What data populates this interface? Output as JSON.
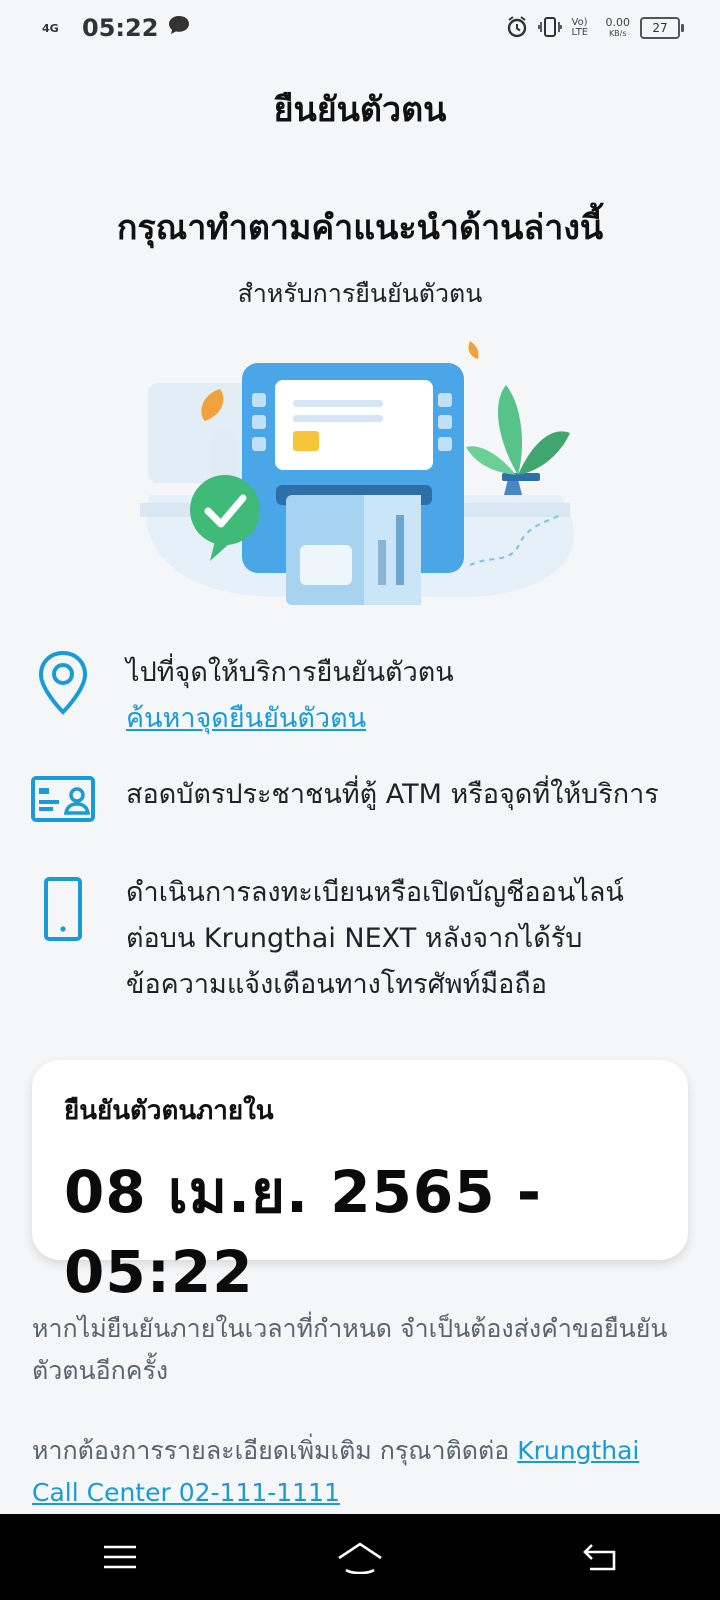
{
  "status_bar": {
    "network": "4G",
    "time": "05:22",
    "lte_label": "Vo) LTE",
    "speed": "0.00",
    "speed_unit": "KB/s",
    "battery": "27"
  },
  "page_title": "ยืนยันตัวตน",
  "heading": "กรุณาทำตามคำแนะนำด้านล่างนี้",
  "subheading": "สำหรับการยืนยันตัวตน",
  "steps": [
    {
      "icon": "location-pin-icon",
      "text": "ไปที่จุดให้บริการยืนยันตัวตน",
      "link": "ค้นหาจุดยืนยันตัวตน"
    },
    {
      "icon": "id-card-icon",
      "text": "สอดบัตรประชาชนที่ตู้ ATM หรือจุดที่ให้บริการ"
    },
    {
      "icon": "smartphone-icon",
      "text_line1": "ดำเนินการลงทะเบียนหรือเปิดบัญชีออนไลน์",
      "text_line2": "ต่อบน Krungthai NEXT หลังจากได้รับ",
      "text_line3": "ข้อความแจ้งเตือนทางโทรศัพท์มือถือ"
    }
  ],
  "deadline": {
    "label": "ยืนยันตัวตนภายใน",
    "value": "08 เม.ย. 2565 - 05:22"
  },
  "notes": {
    "expiry": "หากไม่ยืนยันภายในเวลาที่กำหนด จำเป็นต้องส่งคำขอยืนยันตัวตนอีกครั้ง",
    "contact_prefix": "หากต้องการรายละเอียดเพิ่มเติม กรุณาติดต่อ ",
    "contact_link": "Krungthai Call Center 02-111-1111"
  },
  "colors": {
    "accent": "#1a9bd7",
    "background": "#f4f6f8",
    "check_green": "#3fba78"
  }
}
